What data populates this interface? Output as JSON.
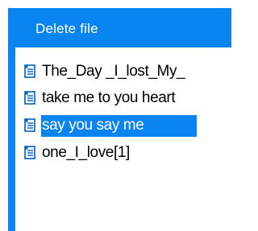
{
  "dialog": {
    "title": "Delete  file"
  },
  "files": [
    {
      "name": "The_Day _I_lost_My_",
      "icon": "document-icon",
      "selected": false
    },
    {
      "name": "take me to you heart",
      "icon": "document-icon",
      "selected": false
    },
    {
      "name": "say you say me",
      "icon": "document-icon",
      "selected": true
    },
    {
      "name": "one_I_love[1]",
      "icon": "document-icon",
      "selected": false
    }
  ],
  "colors": {
    "accent": "#0a84f0",
    "background": "#ffffff",
    "text": "#000000",
    "selected_text": "#ffffff"
  }
}
